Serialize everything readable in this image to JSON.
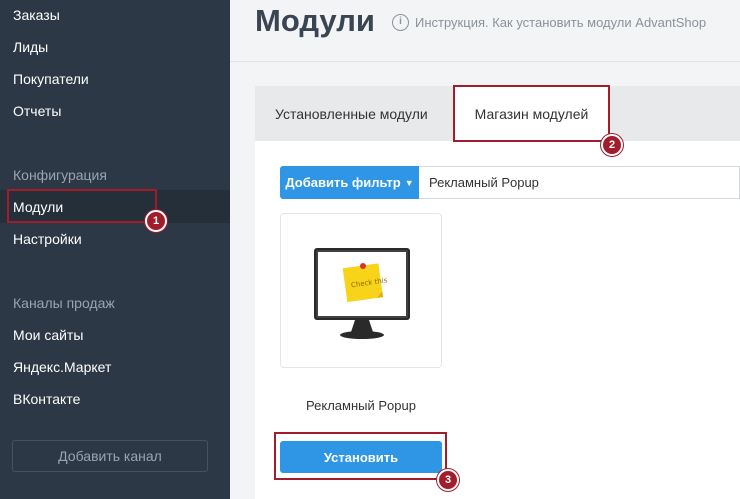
{
  "sidebar": {
    "items_top": [
      "Заказы",
      "Лиды",
      "Покупатели",
      "Отчеты"
    ],
    "config_heading": "Конфигурация",
    "config_items": [
      "Модули",
      "Настройки"
    ],
    "channels_heading": "Каналы продаж",
    "channel_items": [
      "Мои сайты",
      "Яндекс.Маркет",
      "ВКонтакте"
    ],
    "add_channel_label": "Добавить канал"
  },
  "header": {
    "title": "Модули",
    "help_text": "Инструкция. Как установить модули AdvantShop"
  },
  "tabs": {
    "installed": "Установленные модули",
    "store": "Магазин модулей"
  },
  "filter": {
    "button_label": "Добавить фильтр",
    "value": "Рекламный Popup"
  },
  "module_card": {
    "title": "Рекламный Popup",
    "install_label": "Установить",
    "sticky_note_text": "Check this"
  },
  "annotations": [
    "1",
    "2",
    "3"
  ],
  "colors": {
    "sidebar_bg": "#2c3845",
    "accent_blue": "#2f96e6",
    "highlight_red": "#a11d2b"
  }
}
